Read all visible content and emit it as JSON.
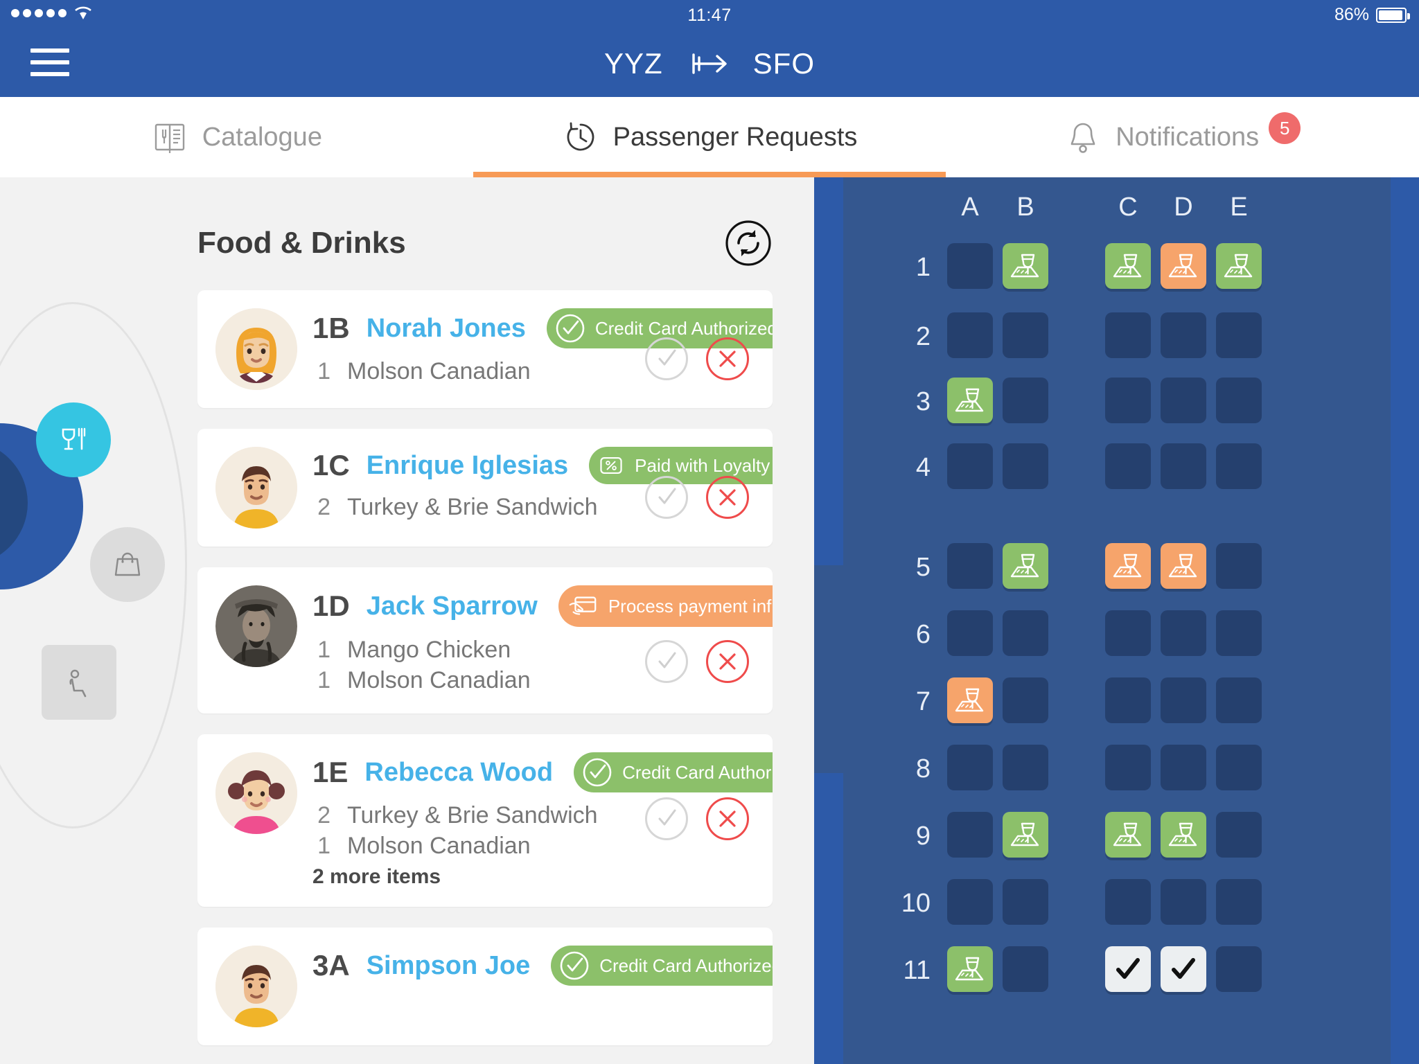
{
  "status_bar": {
    "time": "11:47",
    "battery_text": "86%",
    "signal_dots": 5
  },
  "nav": {
    "menu_icon": "hamburger-icon",
    "origin": "YYZ",
    "destination": "SFO",
    "plane_icon": "airplane-icon"
  },
  "tabs": [
    {
      "id": "catalogue",
      "label": "Catalogue",
      "icon": "menu-book-icon",
      "active": false,
      "badge": null
    },
    {
      "id": "passenger-requests",
      "label": "Passenger Requests",
      "icon": "clock-history-icon",
      "active": true,
      "badge": null
    },
    {
      "id": "notifications",
      "label": "Notifications",
      "icon": "bell-icon",
      "active": false,
      "badge": "5"
    }
  ],
  "left_rail": {
    "items": [
      {
        "id": "food-drinks",
        "icon": "glass-fork-icon",
        "active": true
      },
      {
        "id": "shopping",
        "icon": "shopping-bag-icon",
        "active": false
      },
      {
        "id": "seat",
        "icon": "seated-passenger-icon",
        "active": false
      }
    ]
  },
  "list": {
    "title": "Food & Drinks",
    "refresh_icon": "refresh-icon",
    "accept_icon": "check-circle-icon",
    "reject_icon": "close-circle-icon",
    "cards": [
      {
        "seat": "1B",
        "name": "Norah Jones",
        "avatar": "woman-blonde-avatar",
        "status": {
          "label": "Credit Card Authorized",
          "tone": "green",
          "icon": "check-circle-icon"
        },
        "items": [
          {
            "qty": "1",
            "name": "Molson Canadian"
          }
        ],
        "more": null
      },
      {
        "seat": "1C",
        "name": "Enrique Iglesias",
        "avatar": "man-dark-hair-avatar",
        "status": {
          "label": "Paid with Loyalty Card",
          "tone": "green",
          "icon": "percent-badge-icon"
        },
        "items": [
          {
            "qty": "2",
            "name": "Turkey & Brie Sandwich"
          }
        ],
        "more": null
      },
      {
        "seat": "1D",
        "name": "Jack Sparrow",
        "avatar": "pirate-photo-avatar",
        "status": {
          "label": "Process payment inflight",
          "tone": "orange",
          "icon": "hand-card-icon"
        },
        "items": [
          {
            "qty": "1",
            "name": "Mango Chicken"
          },
          {
            "qty": "1",
            "name": "Molson Canadian"
          }
        ],
        "more": null
      },
      {
        "seat": "1E",
        "name": "Rebecca Wood",
        "avatar": "girl-pigtails-avatar",
        "status": {
          "label": "Credit Card Authorized",
          "tone": "green",
          "icon": "check-circle-icon"
        },
        "items": [
          {
            "qty": "2",
            "name": "Turkey & Brie Sandwich"
          },
          {
            "qty": "1",
            "name": "Molson Canadian"
          }
        ],
        "more": "2 more items"
      },
      {
        "seat": "3A",
        "name": "Simpson Joe",
        "avatar": "man-dark-hair-avatar",
        "status": {
          "label": "Credit Card Authorized",
          "tone": "green",
          "icon": "check-circle-icon"
        },
        "items": [],
        "more": null
      }
    ]
  },
  "seat_map": {
    "columns": [
      "A",
      "B",
      "C",
      "D",
      "E"
    ],
    "rows": [
      "1",
      "2",
      "3",
      "4",
      "5",
      "6",
      "7",
      "8",
      "9",
      "10",
      "11"
    ],
    "seat_icon": "meal-drink-icon",
    "served_icon": "check-icon",
    "states": {
      "1": {
        "A": "empty",
        "B": "green",
        "C": "green",
        "D": "orange",
        "E": "green"
      },
      "2": {
        "A": "empty",
        "B": "empty",
        "C": "empty",
        "D": "empty",
        "E": "empty"
      },
      "3": {
        "A": "green",
        "B": "empty",
        "C": "empty",
        "D": "empty",
        "E": "empty"
      },
      "4": {
        "A": "empty",
        "B": "empty",
        "C": "empty",
        "D": "empty",
        "E": "empty"
      },
      "5": {
        "A": "empty",
        "B": "green",
        "C": "orange",
        "D": "orange",
        "E": "empty"
      },
      "6": {
        "A": "empty",
        "B": "empty",
        "C": "empty",
        "D": "empty",
        "E": "empty"
      },
      "7": {
        "A": "orange",
        "B": "empty",
        "C": "empty",
        "D": "empty",
        "E": "empty"
      },
      "8": {
        "A": "empty",
        "B": "empty",
        "C": "empty",
        "D": "empty",
        "E": "empty"
      },
      "9": {
        "A": "empty",
        "B": "green",
        "C": "green",
        "D": "green",
        "E": "empty"
      },
      "10": {
        "A": "empty",
        "B": "empty",
        "C": "empty",
        "D": "empty",
        "E": "empty"
      },
      "11": {
        "A": "green",
        "B": "empty",
        "C": "white",
        "D": "white",
        "E": "empty"
      }
    }
  },
  "colors": {
    "brand_blue": "#2d5aa8",
    "fuselage": "#34578f",
    "seat_empty": "#25406e",
    "green": "#8cc06a",
    "orange": "#f6a46b",
    "accent_cyan": "#35c5e2",
    "name_blue": "#46b2e8",
    "badge_red": "#ef6b6b",
    "tab_underline": "#f79a56"
  }
}
